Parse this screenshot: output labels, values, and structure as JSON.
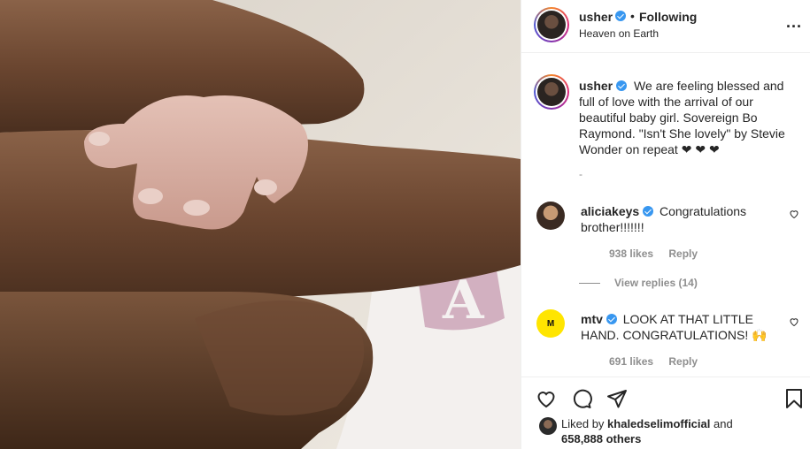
{
  "header": {
    "username": "usher",
    "separator": "•",
    "follow_label": "Following",
    "location": "Heaven on Earth",
    "more": "..."
  },
  "caption": {
    "username": "usher",
    "text": "We are feeling blessed and full of love with the arrival of our beautiful baby girl. Sovereign Bo Raymond. \"Isn't She lovely\" by Stevie Wonder on repeat ❤ ❤ ❤",
    "dash": "-"
  },
  "comments": [
    {
      "username": "aliciakeys",
      "text": "Congratulations brother!!!!!!!",
      "likes": "938 likes",
      "reply": "Reply"
    },
    {
      "username": "mtv",
      "text": "LOOK AT THAT LITTLE HAND. CONGRATULATIONS! 🙌",
      "likes": "691 likes",
      "reply": "Reply"
    }
  ],
  "view_replies": "View replies (14)",
  "likes_section": {
    "prefix": "Liked by",
    "liker": "khaledselimofficial",
    "and": "and",
    "others": "658,888 others"
  },
  "icons": [
    "heart-icon",
    "comment-icon",
    "share-icon",
    "bookmark-icon",
    "verified-icon",
    "more-icon"
  ],
  "colors": {
    "verified": "#3897f0",
    "text": "#262626",
    "muted": "#8e8e8e",
    "mtv_bg": "#ffe500"
  }
}
